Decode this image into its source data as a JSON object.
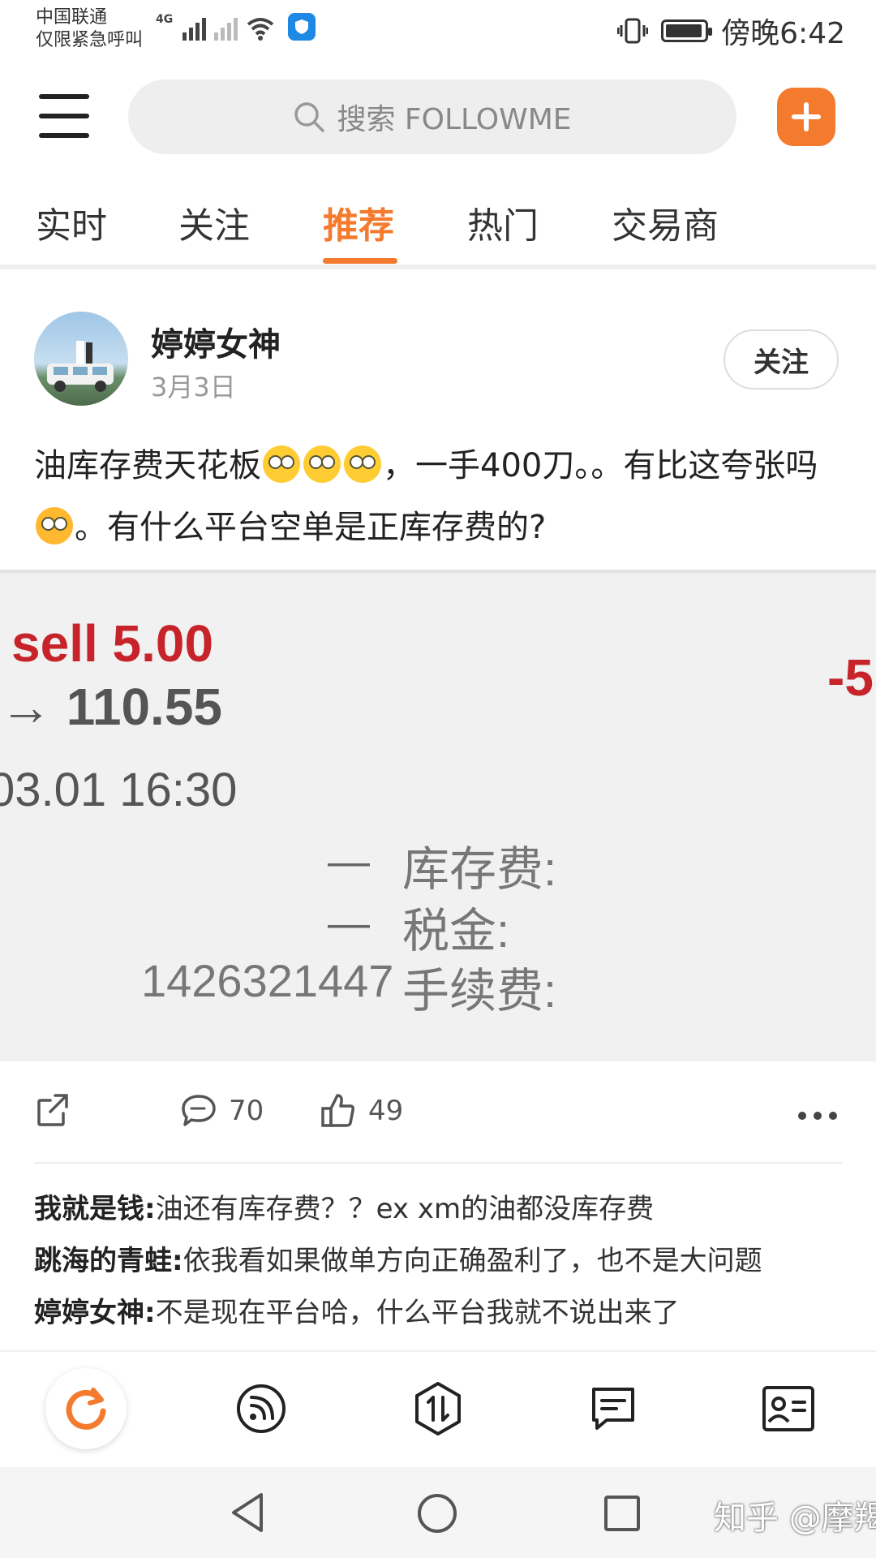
{
  "status_bar": {
    "carrier_line1": "中国联通",
    "carrier_line2": "仅限紧急呼叫",
    "network": "4G",
    "time": "傍晚6:42"
  },
  "top_bar": {
    "search_placeholder": "搜索 FOLLOWME",
    "accent_color": "#f47a2e"
  },
  "tabs": [
    {
      "label": "实时"
    },
    {
      "label": "关注"
    },
    {
      "label": "推荐",
      "active": true
    },
    {
      "label": "热门"
    },
    {
      "label": "交易商"
    }
  ],
  "post": {
    "author": "婷婷女神",
    "date": "3月3日",
    "follow_label": "关注",
    "text_part1": "油库存费天花板",
    "text_part2": "，一手400刀。。有比这夸张吗",
    "text_part3": "。有什么平台空单是正库存费的?",
    "image": {
      "sell_line": "sell 5.00",
      "price_line": "→ 110.55",
      "right_value": "-5",
      "date_line": "03.01 16:30",
      "row1_value": "—",
      "row1_label": "库存费:",
      "row2_value": "—",
      "row2_label": "税金:",
      "row3_value": "1426321447",
      "row3_label": "手续费:"
    },
    "comments_count": "70",
    "likes_count": "49",
    "comments": [
      {
        "user": "我就是钱:",
        "text": "油还有库存费？？ex  xm的油都没库存费"
      },
      {
        "user": "跳海的青蛙:",
        "text": "依我看如果做单方向正确盈利了，也不是大问题"
      },
      {
        "user": "婷婷女神:",
        "text": "不是现在平台哈，什么平台我就不说出来了"
      }
    ]
  },
  "bottom_nav": {
    "icons": [
      "refresh-icon",
      "feed-icon",
      "trade-icon",
      "message-icon",
      "profile-card-icon"
    ]
  },
  "watermark": "知乎 @摩羯怪"
}
